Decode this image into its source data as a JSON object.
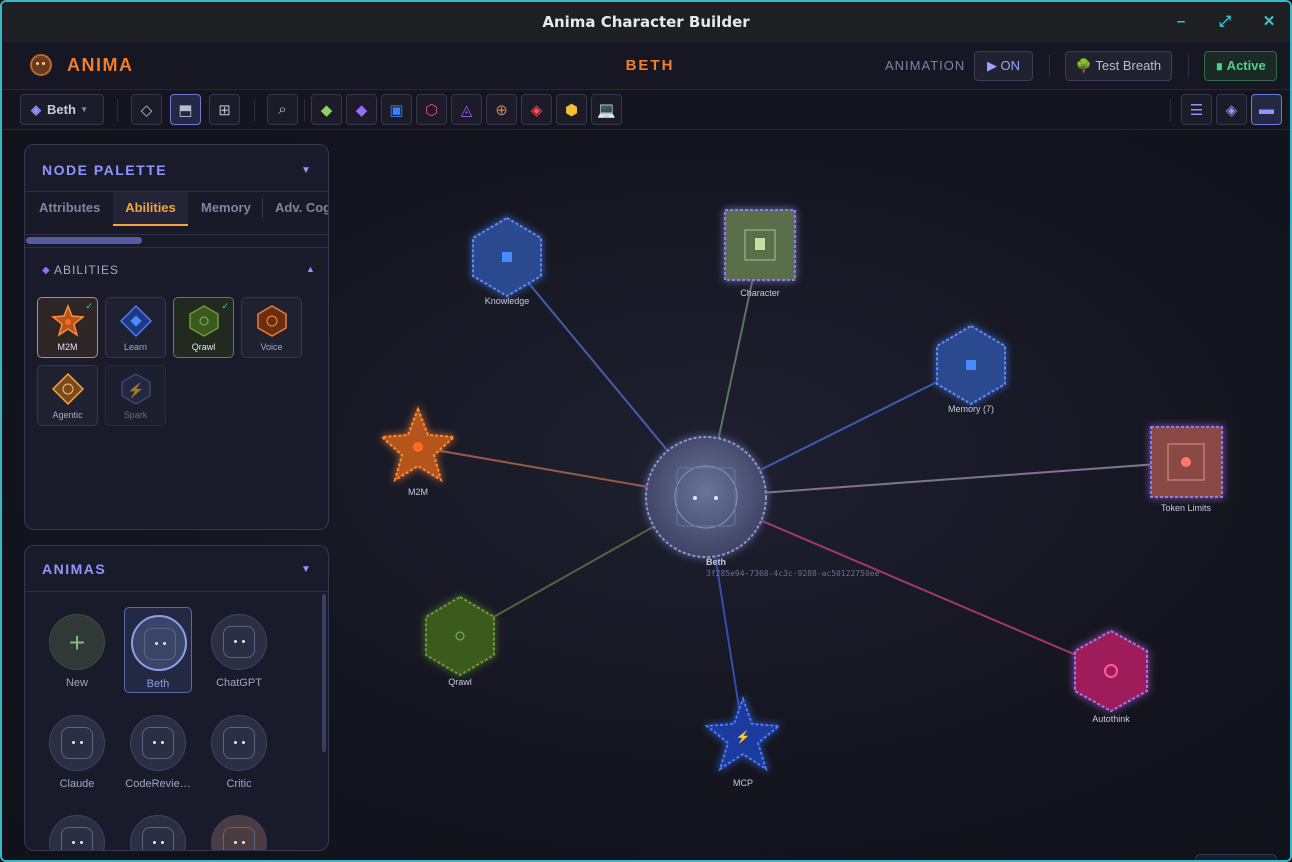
{
  "window": {
    "title": "Anima Character Builder",
    "minimize": "–",
    "maximize": "⤢",
    "close": "✕"
  },
  "header": {
    "brand": "ANIMA",
    "character": "BETH",
    "animation_label": "ANIMATION",
    "on_button": "▶ ON",
    "test_breath": "🌳 Test Breath",
    "active": "∎ Active"
  },
  "toolbar": {
    "character_select": "Beth",
    "select_icon": "◈",
    "dropdown": "▾",
    "view_buttons": [
      "◇",
      "⬒",
      "⊞"
    ],
    "search": "⌕",
    "node_buttons": [
      {
        "icon": "diamond-icon",
        "glyph": "◆",
        "color": "#8fcf6a"
      },
      {
        "icon": "diamond-icon",
        "glyph": "◆",
        "color": "#9a6bff"
      },
      {
        "icon": "square-icon",
        "glyph": "▣",
        "color": "#3d7dff"
      },
      {
        "icon": "hexagon-icon",
        "glyph": "⬡",
        "color": "#ff3d8a"
      },
      {
        "icon": "triangle-icon",
        "glyph": "◬",
        "color": "#9a5bff"
      },
      {
        "icon": "target-icon",
        "glyph": "⊕",
        "color": "#c9865a"
      },
      {
        "icon": "diamond-icon",
        "glyph": "◈",
        "color": "#ff4d5a"
      },
      {
        "icon": "hexagon-icon",
        "glyph": "⬢",
        "color": "#f5c030"
      },
      {
        "icon": "laptop-icon",
        "glyph": "💻",
        "color": "#6ab8ff"
      }
    ],
    "right_buttons": [
      "☰",
      "◈",
      "▬"
    ]
  },
  "palette": {
    "title": "NODE PALETTE",
    "tabs": [
      "Attributes",
      "Abilities",
      "Memory",
      "Adv. Cog"
    ],
    "active_tab": "Abilities",
    "section": "ABILITIES",
    "abilities": [
      {
        "label": "M2M",
        "checked": "✓"
      },
      {
        "label": "Learn",
        "checked": ""
      },
      {
        "label": "Qrawl",
        "checked": "✓"
      },
      {
        "label": "Voice",
        "checked": ""
      },
      {
        "label": "Agentic",
        "checked": ""
      },
      {
        "label": "Spark",
        "checked": ""
      }
    ]
  },
  "animas": {
    "title": "ANIMAS",
    "items": [
      "New",
      "Beth",
      "ChatGPT",
      "Claude",
      "CodeRevie…",
      "Critic"
    ]
  },
  "graph": {
    "center": {
      "label": "Beth",
      "id": "3f285e94-7368-4c3c-9288-ac50122750ee"
    },
    "nodes": [
      "Knowledge",
      "Character",
      "Memory (7)",
      "M2M",
      "Token Limits",
      "Qrawl",
      "MCP",
      "Autothink"
    ]
  }
}
